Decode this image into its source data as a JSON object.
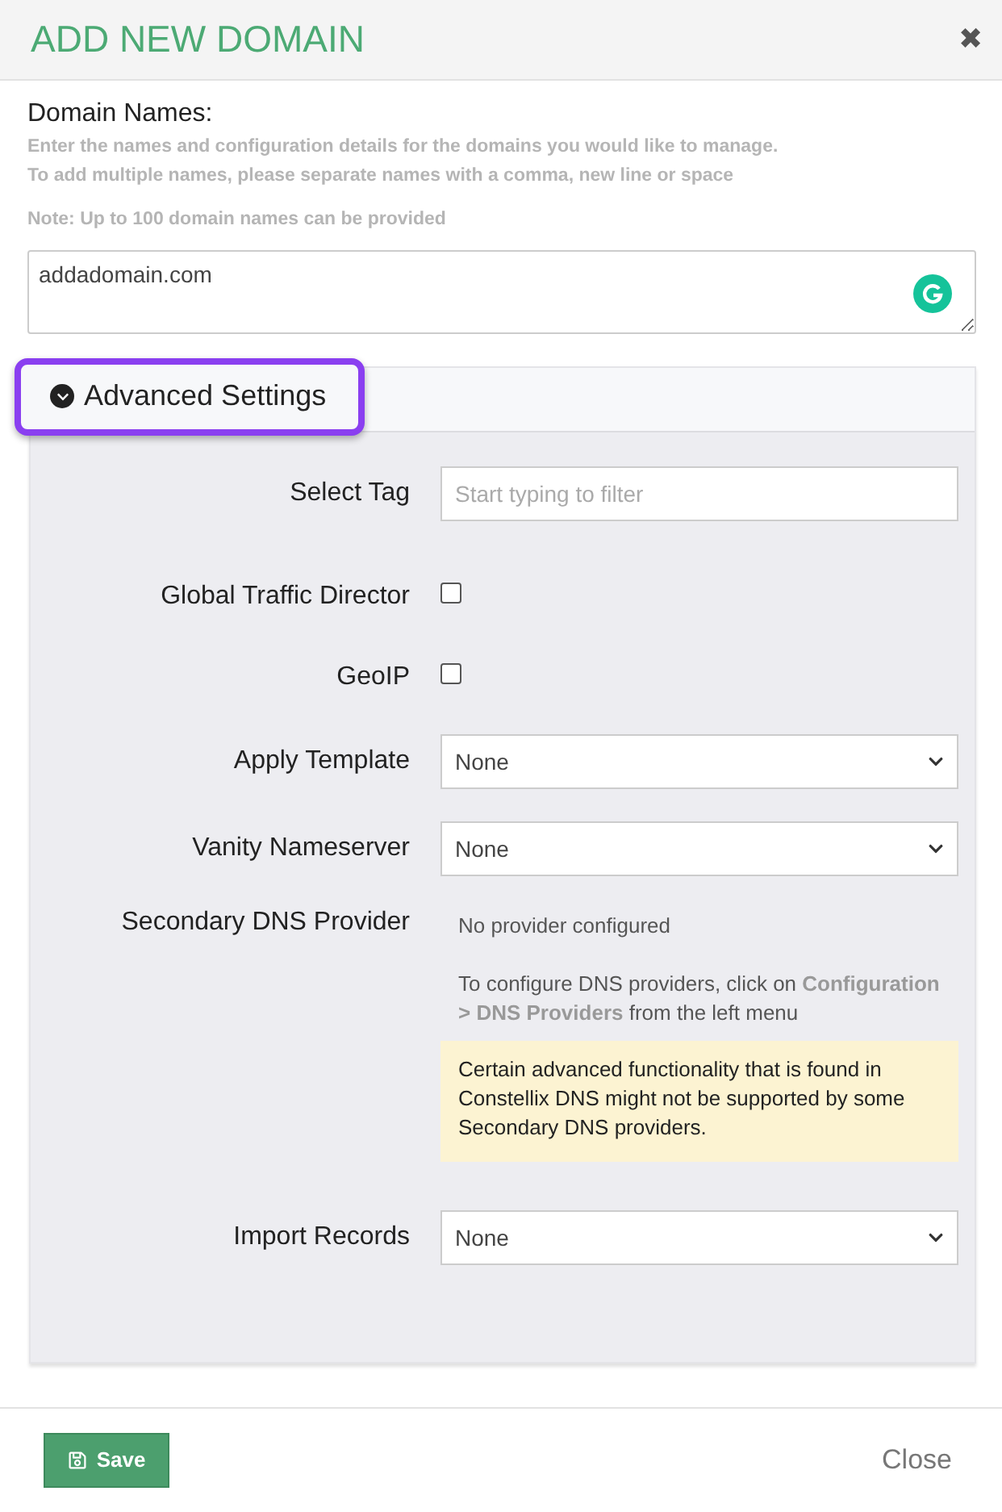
{
  "dialog": {
    "title": "ADD NEW DOMAIN",
    "close_icon": "✖"
  },
  "domain_names": {
    "label": "Domain Names:",
    "help": [
      "Enter the names and configuration details for the domains you would like to manage.",
      "To add multiple names, please separate names with a comma, new line or space"
    ],
    "note": "Note: Up to 100 domain names can be provided",
    "value": "addadomain.com"
  },
  "advanced": {
    "title": "Advanced Settings",
    "expanded": true,
    "highlighted": true,
    "rows": [
      {
        "kind": "text",
        "label": "Select Tag",
        "placeholder": "Start typing to filter"
      },
      {
        "kind": "checkbox",
        "label": "Global Traffic Director",
        "checked": false
      },
      {
        "kind": "checkbox",
        "label": "GeoIP",
        "checked": false
      },
      {
        "kind": "select",
        "label": "Apply Template",
        "value": "None"
      },
      {
        "kind": "select",
        "label": "Vanity Nameserver",
        "value": "None"
      },
      {
        "kind": "info",
        "label": "Secondary DNS Provider",
        "status": "No provider configured",
        "hint": "To configure DNS providers, click on **Configuration > DNS Providers** from the left menu",
        "warning": "Certain advanced functionality that is found in Constellix DNS might not be supported by some Secondary DNS providers."
      },
      {
        "kind": "select",
        "label": "Import Records",
        "value": "None"
      }
    ]
  },
  "footer": {
    "save": "Save",
    "close": "Close"
  }
}
